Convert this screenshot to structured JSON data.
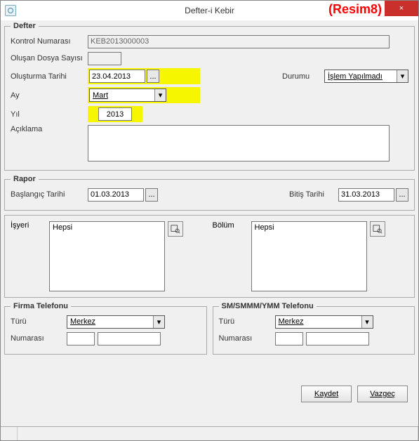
{
  "window": {
    "title": "Defter-i Kebir",
    "annotation": "(Resim8)",
    "close_glyph": "×"
  },
  "defter": {
    "legend": "Defter",
    "kontrol_no_label": "Kontrol Numarası",
    "kontrol_no_value": "KEB2013000003",
    "olusan_dosya_label": "Oluşan Dosya Sayısı",
    "olusan_dosya_value": "",
    "olusturma_tarihi_label": "Oluşturma Tarihi",
    "olusturma_tarihi_value": "23.04.2013",
    "date_btn": "...",
    "durumu_label": "Durumu",
    "durumu_value": "İşlem Yapılmadı",
    "ay_label": "Ay",
    "ay_value": "Mart",
    "yil_label": "Yıl",
    "yil_value": "2013",
    "aciklama_label": "Açıklama",
    "aciklama_value": ""
  },
  "rapor": {
    "legend": "Rapor",
    "baslangic_label": "Başlangıç Tarihi",
    "baslangic_value": "01.03.2013",
    "bitis_label": "Bitiş Tarihi",
    "bitis_value": "31.03.2013",
    "date_btn": "..."
  },
  "filters": {
    "isyeri_label": "İşyeri",
    "isyeri_value": "Hepsi",
    "bolum_label": "Bölüm",
    "bolum_value": "Hepsi"
  },
  "firma_tel": {
    "legend": "Firma Telefonu",
    "turu_label": "Türü",
    "turu_value": "Merkez",
    "numarasi_label": "Numarası",
    "num_a": "",
    "num_b": ""
  },
  "sm_tel": {
    "legend": "SM/SMMM/YMM Telefonu",
    "turu_label": "Türü",
    "turu_value": "Merkez",
    "numarasi_label": "Numarası",
    "num_a": "",
    "num_b": ""
  },
  "buttons": {
    "kaydet": "Kaydet",
    "vazgec": "Vazgeç"
  }
}
